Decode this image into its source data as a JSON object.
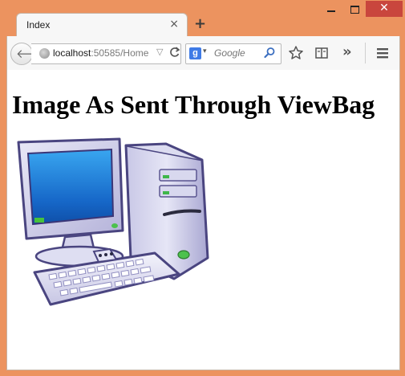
{
  "browser": {
    "tab": {
      "title": "Index",
      "close_glyph": "×"
    },
    "new_tab_glyph": "+",
    "window_controls": {
      "close_glyph": "✕"
    },
    "address": {
      "host": "localhost",
      "rest": ":50585/Home",
      "dropdown_glyph": "▽",
      "reload_glyph": "C"
    },
    "search": {
      "engine_letter": "g",
      "dropdown_glyph": "▾",
      "placeholder": "Google"
    },
    "toolbar": {
      "overflow_glyph": "»"
    }
  },
  "page": {
    "heading": "Image As Sent Through ViewBag",
    "image": {
      "icon": "desktop-computer-icon"
    }
  },
  "colors": {
    "window_frame": "#ec935f",
    "close_button": "#c9463d",
    "search_engine": "#3f7be6"
  }
}
